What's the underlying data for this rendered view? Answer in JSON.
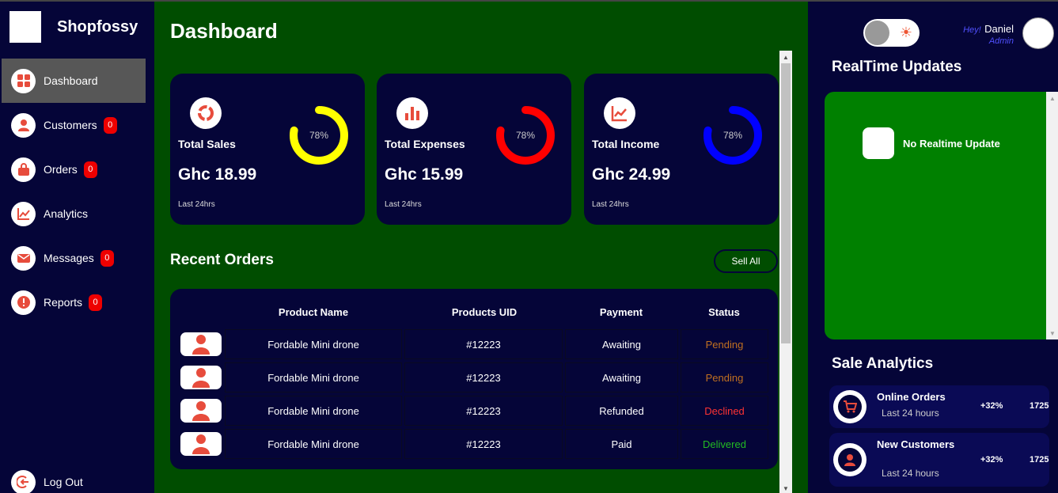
{
  "brand": {
    "name": "Shopfossy"
  },
  "sidebar": {
    "items": [
      {
        "label": "Dashboard",
        "icon": "grid-icon",
        "badge": null
      },
      {
        "label": "Customers",
        "icon": "person-icon",
        "badge": "0"
      },
      {
        "label": "Orders",
        "icon": "bag-icon",
        "badge": "0"
      },
      {
        "label": "Analytics",
        "icon": "chart-line-icon",
        "badge": null
      },
      {
        "label": "Messages",
        "icon": "mail-icon",
        "badge": "0"
      },
      {
        "label": "Reports",
        "icon": "alert-icon",
        "badge": "0"
      }
    ],
    "logout": "Log Out"
  },
  "main": {
    "title": "Dashboard",
    "cards": [
      {
        "title": "Total Sales",
        "value": "Ghc 18.99",
        "foot": "Last 24hrs",
        "percent": "78%",
        "progress": 0.78,
        "ring_color": "#ffff00",
        "icon": "donut-icon"
      },
      {
        "title": "Total Expenses",
        "value": "Ghc 15.99",
        "foot": "Last 24hrs",
        "percent": "78%",
        "progress": 0.78,
        "ring_color": "#ff0000",
        "icon": "bar-chart-icon"
      },
      {
        "title": "Total Income",
        "value": "Ghc 24.99",
        "foot": "Last 24hrs",
        "percent": "78%",
        "progress": 0.78,
        "ring_color": "#0000ff",
        "icon": "trend-chart-icon"
      }
    ],
    "recent_orders": {
      "title": "Recent Orders",
      "sell_all": "Sell All",
      "headers": [
        "Product Name",
        "Products UID",
        "Payment",
        "Status"
      ],
      "rows": [
        {
          "name": "Fordable Mini drone",
          "uid": "#12223",
          "payment": "Awaiting",
          "status": "Pending",
          "status_color": "#c07020"
        },
        {
          "name": "Fordable Mini drone",
          "uid": "#12223",
          "payment": "Awaiting",
          "status": "Pending",
          "status_color": "#c07020"
        },
        {
          "name": "Fordable Mini drone",
          "uid": "#12223",
          "payment": "Refunded",
          "status": "Declined",
          "status_color": "#ff3333"
        },
        {
          "name": "Fordable Mini drone",
          "uid": "#12223",
          "payment": "Paid",
          "status": "Delivered",
          "status_color": "#22bb22"
        }
      ]
    }
  },
  "right": {
    "greeting": {
      "hey": "Hey!",
      "name": "Daniel",
      "role": "Admin"
    },
    "realtime": {
      "title": "RealTime Updates",
      "message": "No Realtime Update"
    },
    "sale_analytics": {
      "title": "Sale Analytics",
      "items": [
        {
          "name": "Online Orders",
          "sub": "Last 24 hours",
          "pct": "+32%",
          "count": "1725",
          "icon": "cart-icon"
        },
        {
          "name": "New Customers",
          "sub": "Last 24 hours",
          "pct": "+32%",
          "count": "1725",
          "icon": "person-icon"
        }
      ]
    }
  },
  "colors": {
    "sidebar": "#050538",
    "main": "#004d00",
    "accent": "#e74c3c",
    "realtime": "#008000"
  }
}
